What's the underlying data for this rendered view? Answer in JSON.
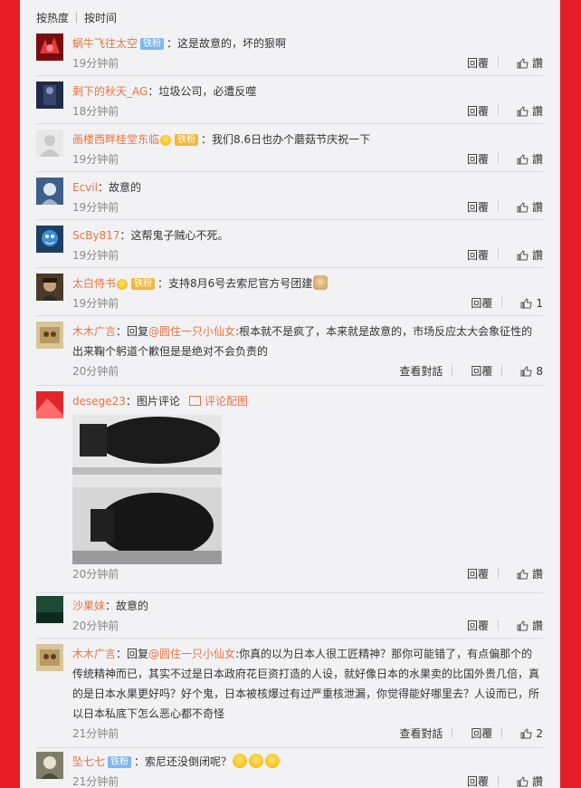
{
  "sort_tabs": {
    "hot": "按热度",
    "time": "按时间"
  },
  "action_labels": {
    "reply": "回覆",
    "view_conversation": "查看對話"
  },
  "colors": {
    "page_bg": "#e51d24",
    "panel_bg": "#f2f2f5",
    "username": "#eb7340"
  },
  "comments": [
    {
      "user": "蜗牛飞往太空",
      "badge": "铁粉",
      "sep": "：",
      "text": "这是故意的，坏的狠啊",
      "time": "19分钟前",
      "like": "讚"
    },
    {
      "user": "剩下的秋天_AG",
      "sep": "：",
      "text": "垃圾公司，必遭反噬",
      "time": "18分钟前",
      "like": "讚"
    },
    {
      "user": "画楼西畔桂堂东临",
      "badge": "铁粉",
      "sep": "：",
      "text": "我们8.6日也办个蘑菇节庆祝一下",
      "time": "19分钟前",
      "like": "讚"
    },
    {
      "user": "Ecvil",
      "sep": "：",
      "text": "故意的",
      "time": "19分钟前",
      "like": "讚"
    },
    {
      "user": "ScBy817",
      "sep": "：",
      "text": "这帮鬼子贼心不死。",
      "time": "19分钟前",
      "like": "讚"
    },
    {
      "user": "太白侍书",
      "badge": "铁粉",
      "sep": "：",
      "text": "支持8月6号去索尼官方号团建",
      "time": "19分钟前",
      "like": "1"
    },
    {
      "user": "木木广言",
      "sep": "：",
      "reply_prefix": "回复",
      "mention": "@圆住一只小仙女",
      "text": ":根本就不是疯了，本来就是故意的，市场反应太大会象征性的出来鞠个躬道个歉但是是绝对不会负责的",
      "time": "20分钟前",
      "like": "8"
    },
    {
      "user": "desege23",
      "sep": "：",
      "text": "图片评论",
      "pic_link": "评论配图",
      "image_alt": "原子弹图片",
      "time": "20分钟前",
      "like": "讚"
    },
    {
      "user": "沙果妹",
      "sep": "：",
      "text": "故意的",
      "time": "20分钟前",
      "like": "讚"
    },
    {
      "user": "木木广言",
      "sep": "：",
      "reply_prefix": "回复",
      "mention": "@圆住一只小仙女",
      "text": ":你真的以为日本人很工匠精神？那你可能错了，有点偏那个的传统精神而已，其实不过是日本政府花巨资打造的人设，就好像日本的水果卖的比国外贵几倍，真的是日本水果更好吗？好个鬼，日本被核爆过有过严重核泄漏，你觉得能好哪里去？人设而已，所以日本私底下怎么恶心都不奇怪",
      "time": "21分钟前",
      "like": "2"
    },
    {
      "user": "坠七七",
      "badge": "铁粉",
      "sep": "：",
      "text": "索尼还没倒闭呢？",
      "time": "21分钟前",
      "like": "讚"
    }
  ]
}
